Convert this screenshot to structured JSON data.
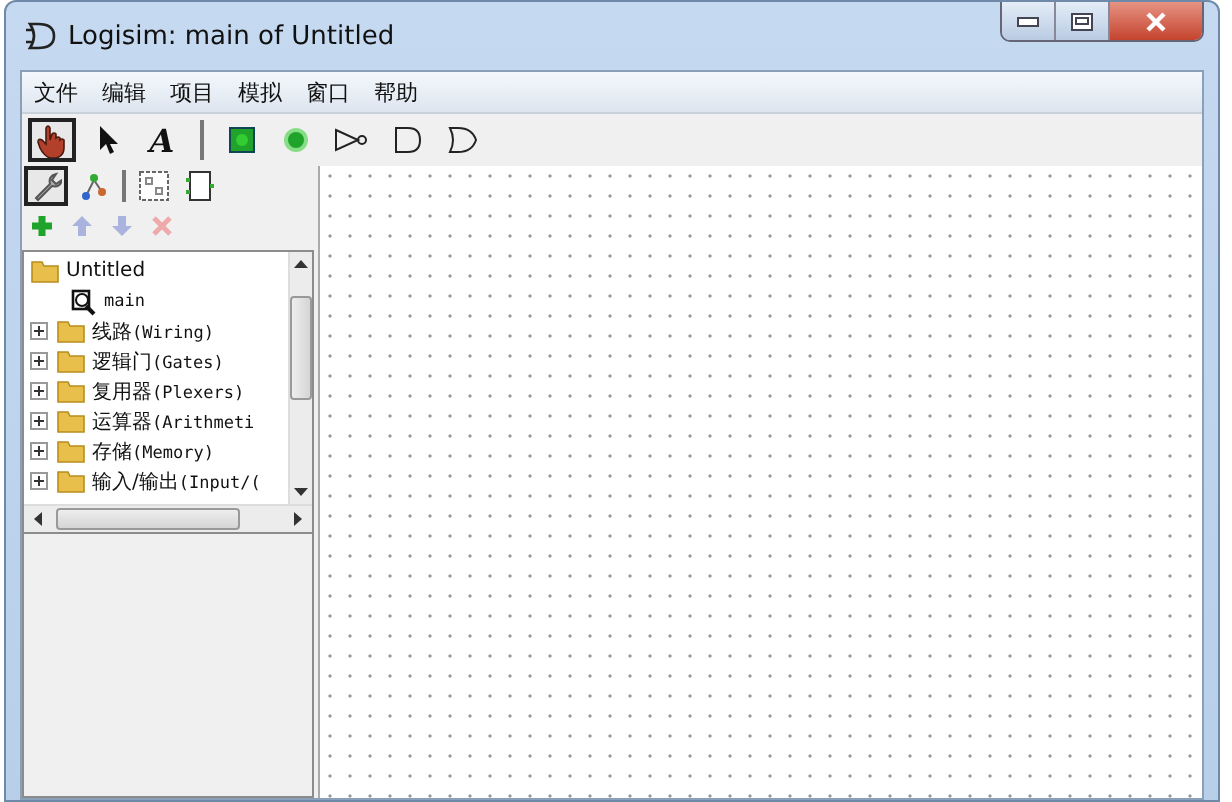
{
  "window": {
    "title": "Logisim: main of Untitled"
  },
  "menu": [
    "文件",
    "编辑",
    "项目",
    "模拟",
    "窗口",
    "帮助"
  ],
  "toolbar": [
    {
      "kind": "hand",
      "selected": true
    },
    {
      "kind": "arrow",
      "selected": false
    },
    {
      "kind": "text",
      "glyph": "A",
      "selected": false
    },
    {
      "kind": "sep"
    },
    {
      "kind": "input",
      "selected": false
    },
    {
      "kind": "output",
      "selected": false
    },
    {
      "kind": "not",
      "selected": false
    },
    {
      "kind": "and",
      "selected": false
    },
    {
      "kind": "or",
      "selected": false
    }
  ],
  "explorer_toolbar": [
    {
      "kind": "wrench",
      "selected": true
    },
    {
      "kind": "tree",
      "selected": false
    },
    {
      "kind": "sep"
    },
    {
      "kind": "layout",
      "selected": false
    },
    {
      "kind": "appearance",
      "selected": false
    }
  ],
  "explorer_actions": [
    {
      "kind": "add",
      "disabled": false
    },
    {
      "kind": "up",
      "disabled": true
    },
    {
      "kind": "down",
      "disabled": true
    },
    {
      "kind": "delete",
      "disabled": true
    }
  ],
  "tree": [
    {
      "label": "Untitled",
      "kind": "project",
      "children": [
        {
          "label": "main",
          "kind": "circuit"
        }
      ]
    },
    {
      "label": "线路",
      "latin": "(Wiring)",
      "kind": "library",
      "expanded": false
    },
    {
      "label": "逻辑门",
      "latin": "(Gates)",
      "kind": "library",
      "expanded": false
    },
    {
      "label": "复用器",
      "latin": "(Plexers)",
      "kind": "library",
      "expanded": false
    },
    {
      "label": "运算器",
      "latin": "(Arithmeti",
      "kind": "library",
      "expanded": false
    },
    {
      "label": "存储",
      "latin": "(Memory)",
      "kind": "library",
      "expanded": false
    },
    {
      "label": "输入/输出",
      "latin": "(Input/(",
      "kind": "library",
      "expanded": false
    }
  ]
}
